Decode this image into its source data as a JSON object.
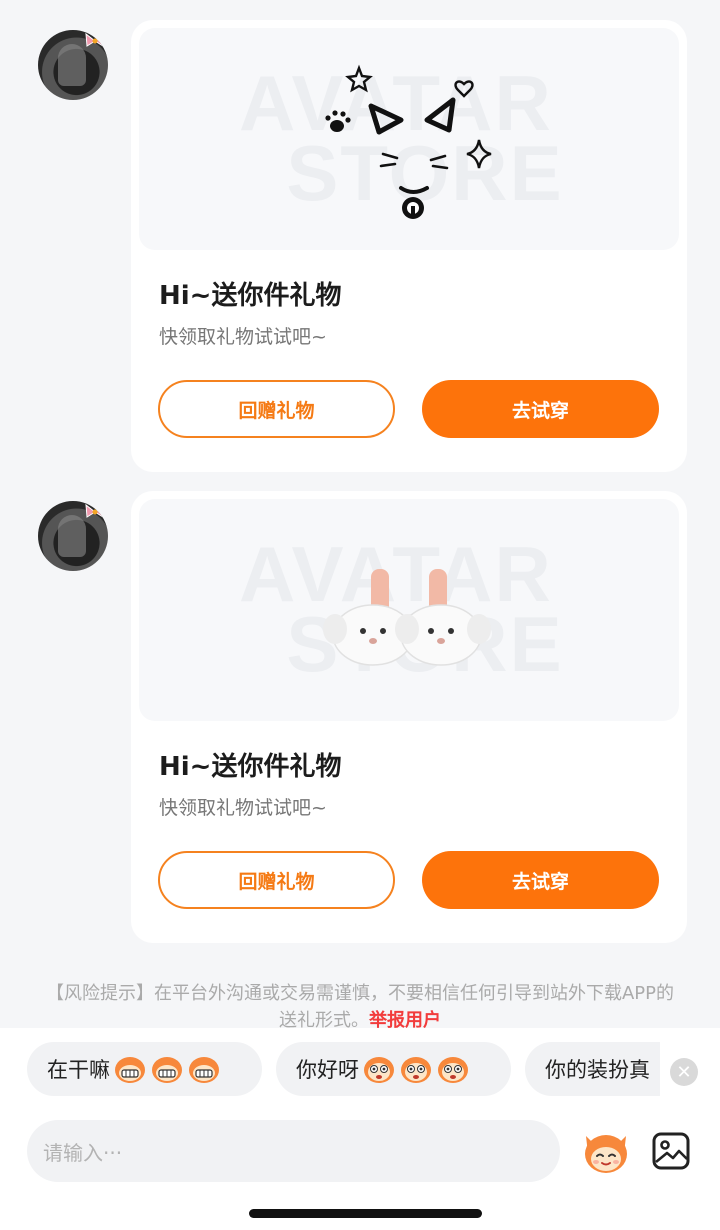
{
  "messages": [
    {
      "gift": "cat-face-sticker",
      "title": "Hi~送你件礼物",
      "subtitle": "快领取礼物试试吧~",
      "return_gift_label": "回赠礼物",
      "try_on_label": "去试穿",
      "watermark": "AVATAR STORE"
    },
    {
      "gift": "plush-slippers",
      "title": "Hi~送你件礼物",
      "subtitle": "快领取礼物试试吧~",
      "return_gift_label": "回赠礼物",
      "try_on_label": "去试穿",
      "watermark": "AVATAR STORE"
    }
  ],
  "risk_notice": {
    "text": "【风险提示】在平台外沟通或交易需谨慎，不要相信任何引导到站外下载APP的送礼形式。",
    "report_label": "举报用户"
  },
  "quick_replies": [
    {
      "text": "在干嘛",
      "emoji": "grinning-mascot-emoji x3"
    },
    {
      "text": "你好呀",
      "emoji": "monkey-mascot-emoji x3"
    },
    {
      "text": "你的装扮真",
      "emoji": ""
    }
  ],
  "input": {
    "placeholder": "请输入···"
  },
  "colors": {
    "accent": "#fd730b",
    "accent_outline": "#f5821f",
    "report": "#f23c3c",
    "background": "#f5f6f8"
  },
  "icons": [
    "close-icon",
    "mascot-emoji-icon",
    "image-icon"
  ]
}
